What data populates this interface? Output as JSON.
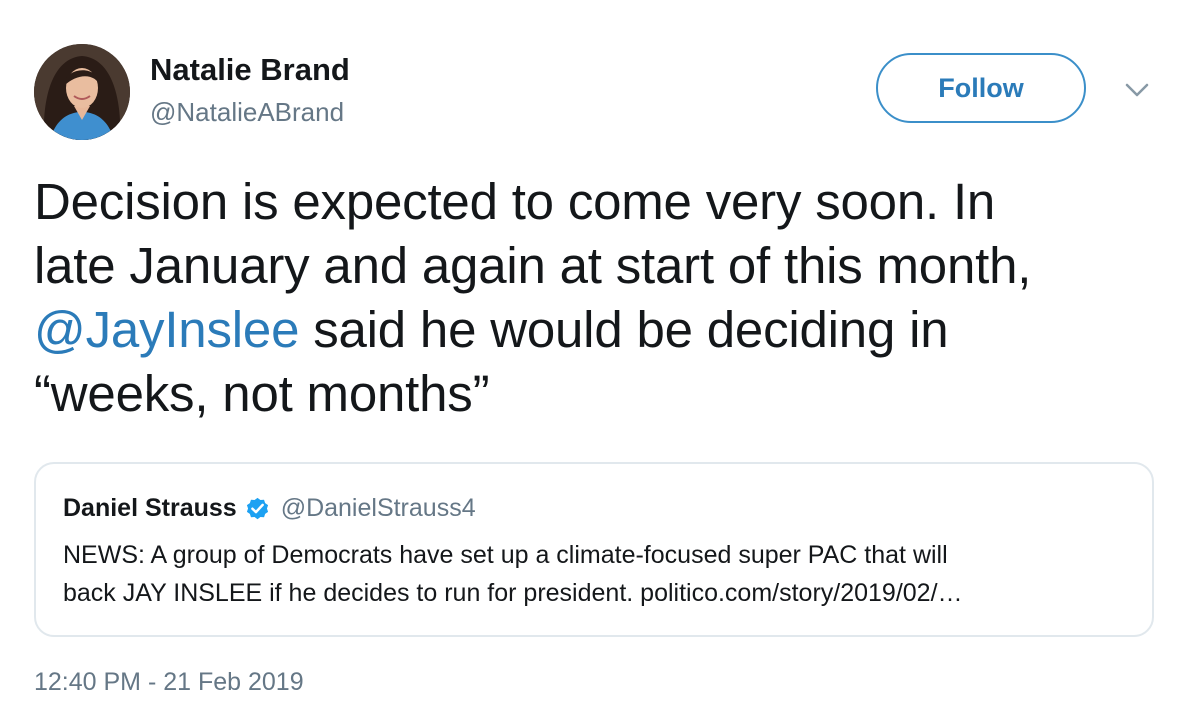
{
  "author": {
    "name": "Natalie Brand",
    "handle": "@NatalieABrand",
    "avatar_icon": "user-avatar-photo"
  },
  "actions": {
    "follow_label": "Follow",
    "caret_icon": "chevron-down-icon"
  },
  "tweet": {
    "lines": [
      "Decision is expected to come very soon. In",
      "late January and again at start of this month,"
    ],
    "line3_mention": "@JayInslee",
    "line3_rest": " said he would be deciding in",
    "line4": "“weeks, not months”"
  },
  "quoted_tweet": {
    "name": "Daniel Strauss",
    "verified_icon": "verified-badge-icon",
    "handle": "@DanielStrauss4",
    "lines": [
      "NEWS: A group of Democrats have set up a climate-focused super PAC that will",
      "back JAY INSLEE if he decides to run for president. politico.com/story/2019/02/…"
    ]
  },
  "timestamp": "12:40 PM - 21 Feb 2019",
  "colors": {
    "link": "#2b7bb9",
    "secondary_text": "#657786",
    "primary_text": "#14171a",
    "border": "#e1e8ed",
    "verified": "#1da1f2"
  }
}
